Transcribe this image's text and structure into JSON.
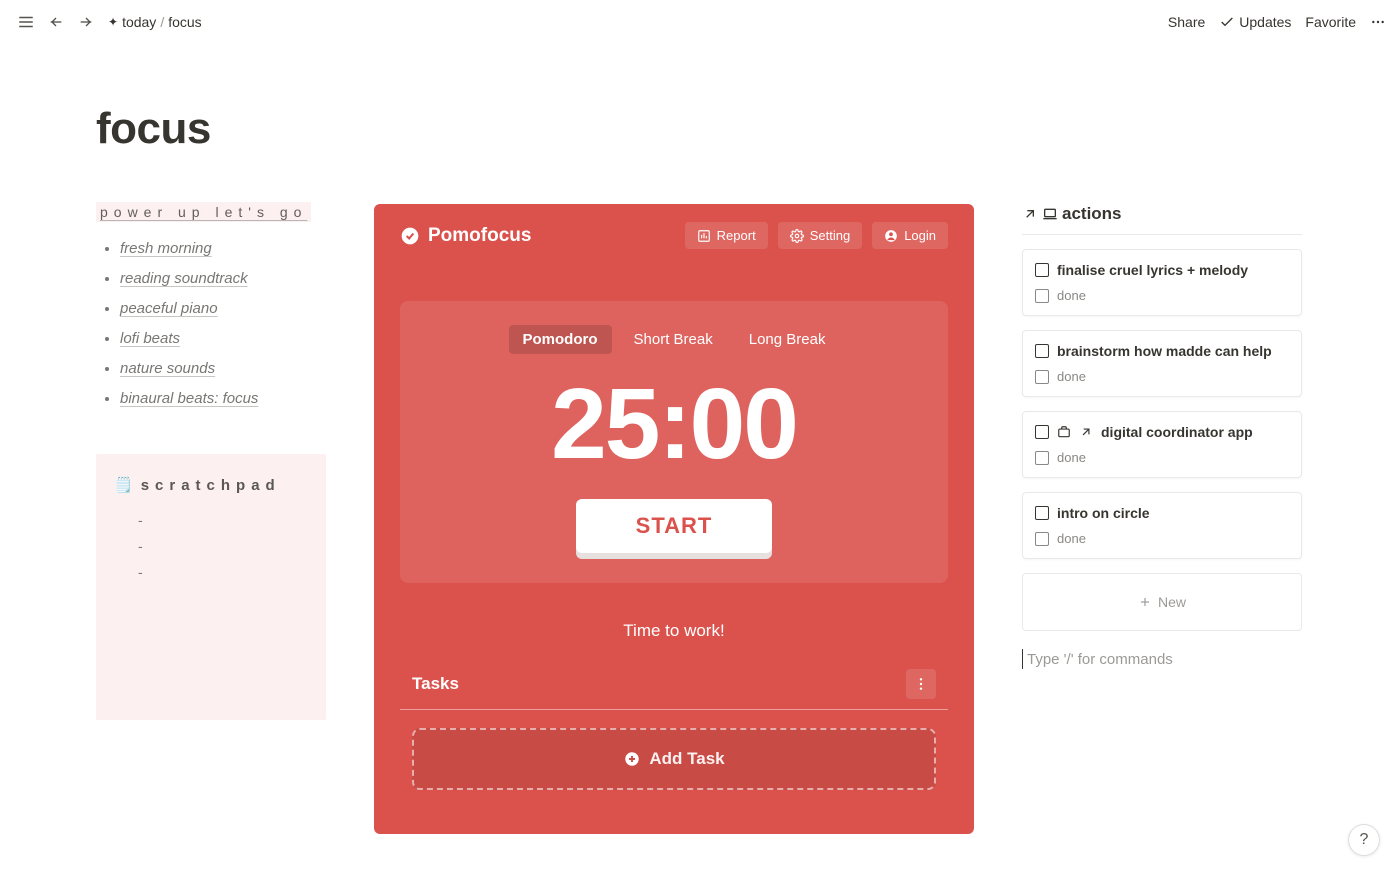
{
  "topbar": {
    "breadcrumb": {
      "root": "today",
      "current": "focus"
    },
    "share": "Share",
    "updates": "Updates",
    "favorite": "Favorite"
  },
  "page": {
    "title": "focus"
  },
  "left": {
    "power_heading": "power up let's go",
    "playlist": [
      "fresh morning",
      "reading soundtrack",
      "peaceful piano",
      "lofi beats",
      "nature sounds",
      "binaural beats: focus"
    ],
    "scratchpad": {
      "emoji": "🗒️",
      "heading": "scratchpad",
      "items": [
        "-",
        "-",
        "-"
      ]
    }
  },
  "pomo": {
    "brand": "Pomofocus",
    "report": "Report",
    "setting": "Setting",
    "login": "Login",
    "tabs": {
      "pomodoro": "Pomodoro",
      "short": "Short Break",
      "long": "Long Break"
    },
    "time": "25:00",
    "start": "START",
    "message": "Time to work!",
    "tasks_label": "Tasks",
    "add_task": "Add Task"
  },
  "actions": {
    "heading": "actions",
    "done_label": "done",
    "cards": [
      {
        "title": "finalise cruel lyrics + melody",
        "link": false
      },
      {
        "title": "brainstorm how madde can help",
        "link": false
      },
      {
        "title": "digital coordinator app",
        "link": true
      },
      {
        "title": "intro on circle",
        "link": false
      }
    ],
    "new_label": "New",
    "slash_placeholder": "Type '/' for commands"
  },
  "help": "?"
}
